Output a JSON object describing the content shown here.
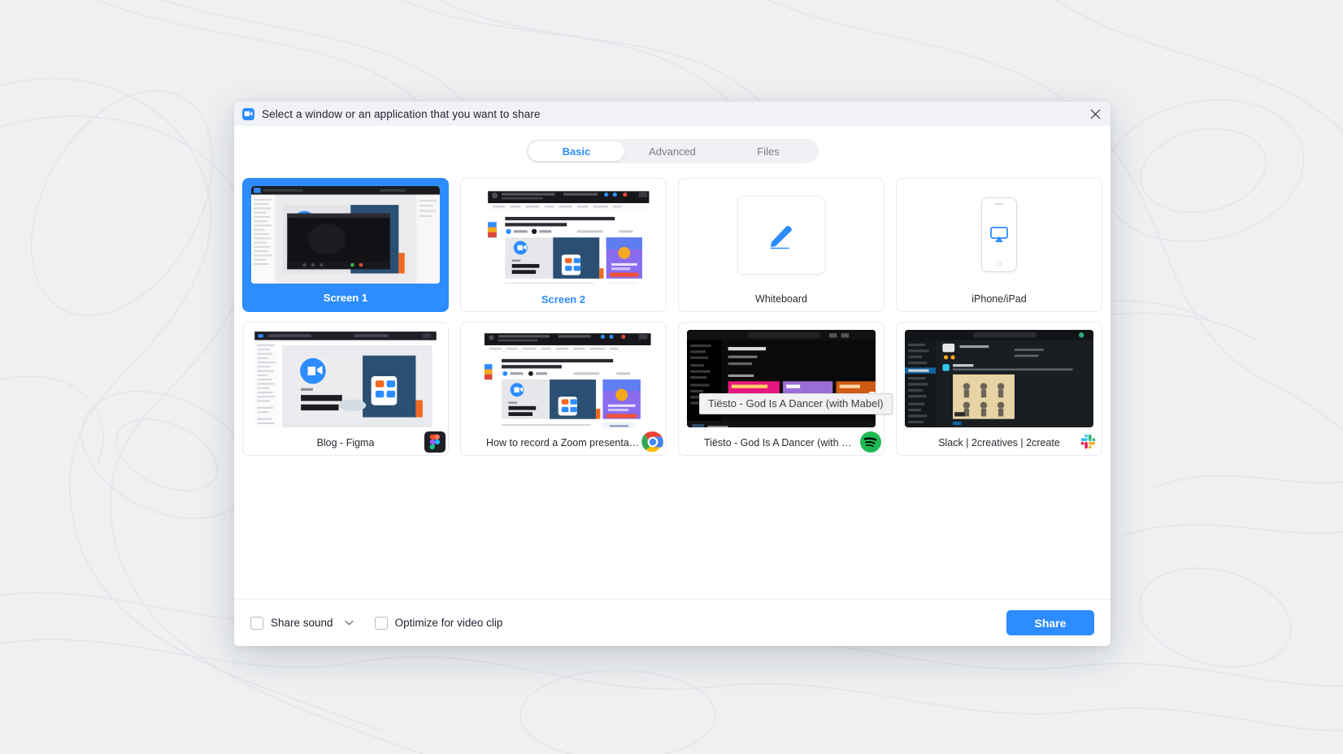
{
  "window": {
    "title": "Select a window or an application that you want to share",
    "logo_icon": "zoom-logo-icon",
    "close_icon": "close-icon"
  },
  "tabs": [
    {
      "label": "Basic",
      "active": true
    },
    {
      "label": "Advanced",
      "active": false
    },
    {
      "label": "Files",
      "active": false
    }
  ],
  "sources": [
    {
      "label": "Screen 1",
      "state": "selected",
      "kind": "screen",
      "badge": ""
    },
    {
      "label": "Screen 2",
      "state": "highlight",
      "kind": "screen2",
      "badge": ""
    },
    {
      "label": "Whiteboard",
      "state": "normal",
      "kind": "whiteboard",
      "badge": ""
    },
    {
      "label": "iPhone/iPad",
      "state": "normal",
      "kind": "iphone",
      "badge": ""
    },
    {
      "label": "Blog - Figma",
      "state": "normal",
      "kind": "figma",
      "badge": "figma-icon"
    },
    {
      "label": "How to record a Zoom presentati...",
      "state": "normal",
      "kind": "chrome",
      "badge": "chrome-icon"
    },
    {
      "label": "Tiësto - God Is A Dancer (with Ma...",
      "state": "normal",
      "kind": "spotify",
      "badge": "spotify-icon"
    },
    {
      "label": "Slack | 2creatives | 2create",
      "state": "normal",
      "kind": "slack",
      "badge": "slack-icon"
    }
  ],
  "tooltip": {
    "text": "Tiësto - God Is A Dancer (with Mabel)"
  },
  "footer": {
    "share_sound_label": "Share sound",
    "share_sound_checked": false,
    "share_sound_dropdown_icon": "chevron-down-icon",
    "optimize_label": "Optimize for video clip",
    "optimize_checked": false,
    "share_button_label": "Share"
  },
  "colors": {
    "accent": "#2d8cff",
    "background": "#eef0f2",
    "titlebar": "#f1f2f6",
    "tab_inactive": "#7a7a87"
  },
  "slide": {
    "kicker": "How To:",
    "title_line1": "Record a Zoom",
    "title_line2": "Presentation"
  },
  "browser_page": {
    "heading_line1": "How to record a Zoom presentation and present in a",
    "heading_line2": "virtual meeting?"
  },
  "spotify": {
    "tile1": "Dance / Electronic",
    "tile2": "Pop",
    "tile3": "Hip-Hop"
  }
}
